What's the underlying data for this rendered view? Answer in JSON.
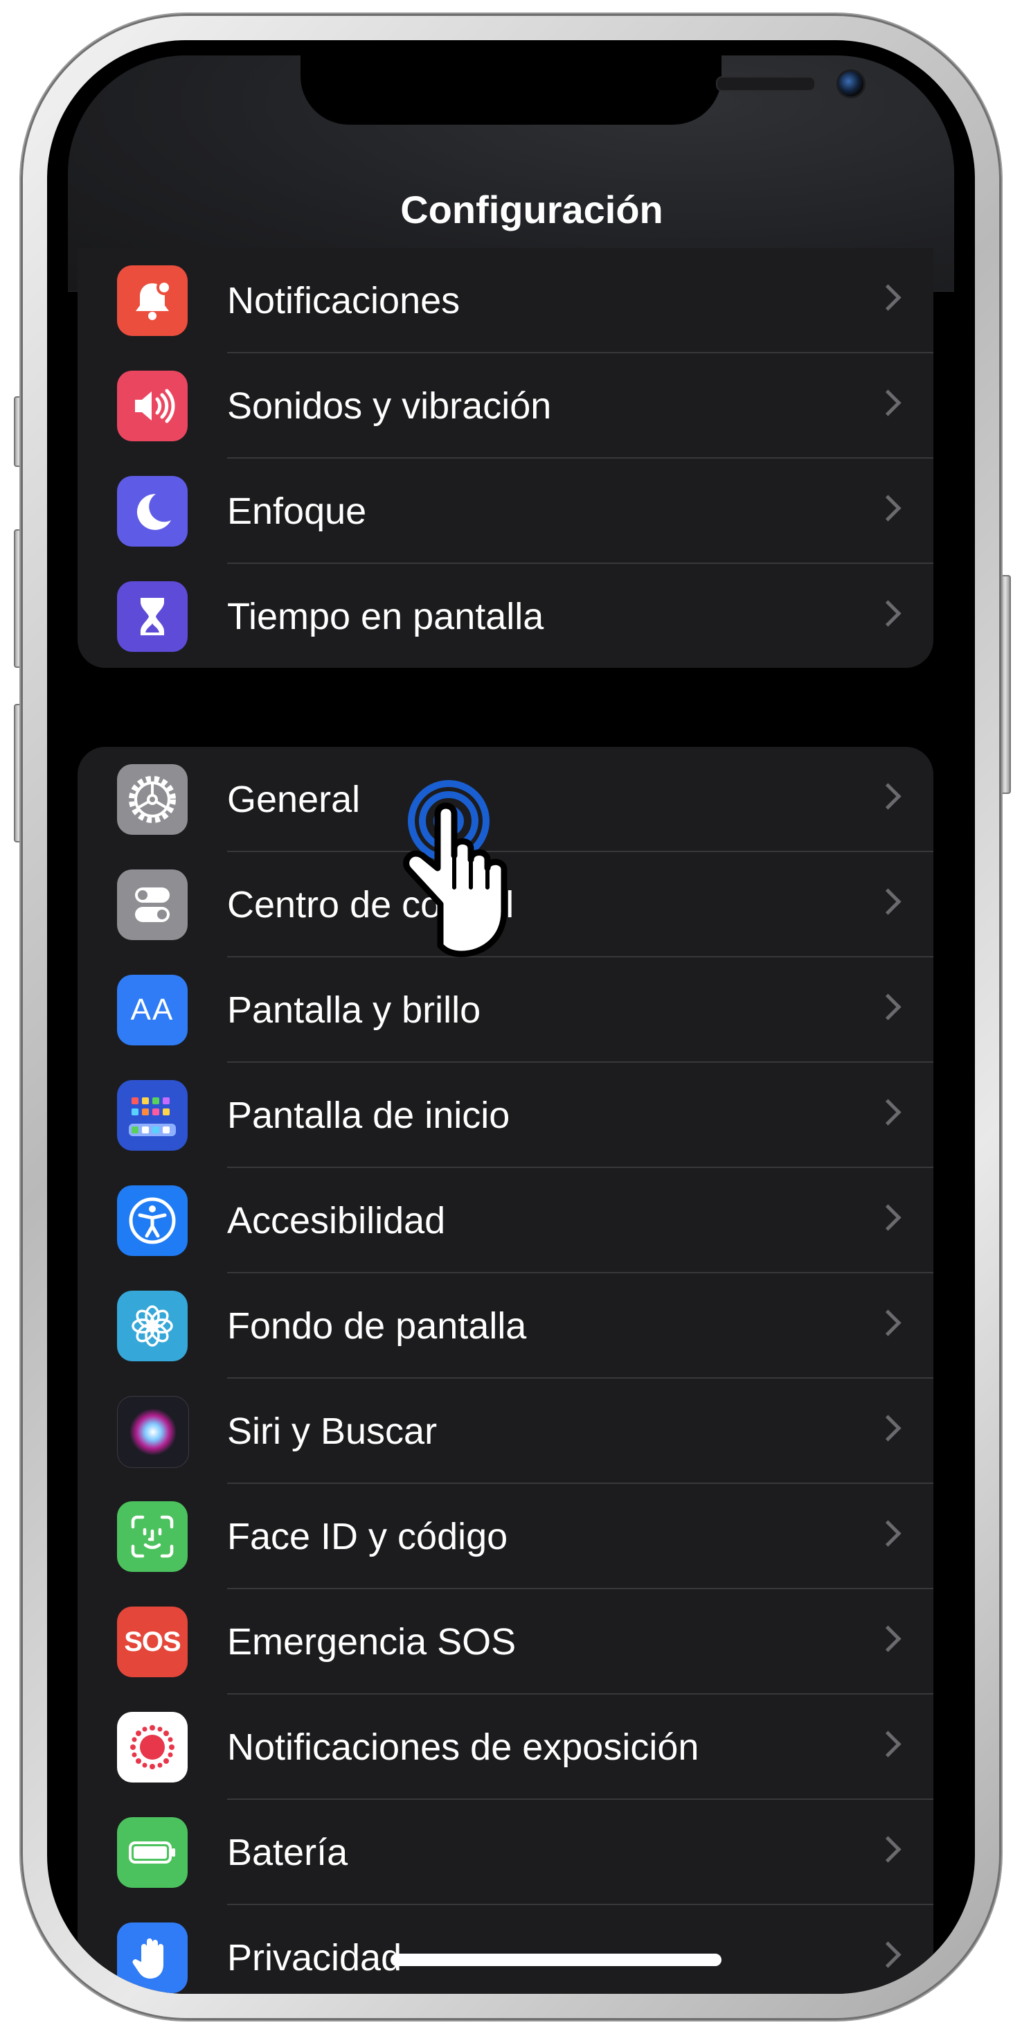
{
  "screen": {
    "title": "Configuración"
  },
  "groups": [
    {
      "items": [
        {
          "label": "Notificaciones",
          "icon": "notifications-bell-icon",
          "color": "#eb4e3d"
        },
        {
          "label": "Sonidos y vibración",
          "icon": "speaker-sound-icon",
          "color": "#eb4660"
        },
        {
          "label": "Enfoque",
          "icon": "moon-icon",
          "color": "#5e5ce6"
        },
        {
          "label": "Tiempo en pantalla",
          "icon": "hourglass-icon",
          "color": "#5e4bd8"
        }
      ]
    },
    {
      "items": [
        {
          "label": "General",
          "icon": "gear-icon",
          "color": "#8e8e93"
        },
        {
          "label": "Centro de control",
          "icon": "toggles-icon",
          "color": "#8e8e93"
        },
        {
          "label": "Pantalla y brillo",
          "icon": "text-size-icon",
          "color": "#2f7cf6",
          "glyph": "AA"
        },
        {
          "label": "Pantalla de inicio",
          "icon": "home-screen-grid-icon",
          "color": "#2e53d1"
        },
        {
          "label": "Accesibilidad",
          "icon": "accessibility-icon",
          "color": "#1f7cf4"
        },
        {
          "label": "Fondo de pantalla",
          "icon": "flower-icon",
          "color": "#35a7d8"
        },
        {
          "label": "Siri y Buscar",
          "icon": "siri-icon",
          "color": "#1c1c24"
        },
        {
          "label": "Face ID y código",
          "icon": "face-id-icon",
          "color": "#4cc25e"
        },
        {
          "label": "Emergencia SOS",
          "icon": "sos-icon",
          "color": "#e5463a",
          "glyph": "SOS"
        },
        {
          "label": "Notificaciones de exposición",
          "icon": "exposure-notification-icon",
          "color": "#ffffff"
        },
        {
          "label": "Batería",
          "icon": "battery-icon",
          "color": "#4cc25e"
        },
        {
          "label": "Privacidad",
          "icon": "hand-icon",
          "color": "#2f7cf6"
        }
      ]
    }
  ],
  "colors": {
    "background": "#000000",
    "row_background": "#1c1c1e",
    "chevron": "#6b6b6f",
    "tap_ring": "#1a5fd1"
  },
  "overlay": {
    "pointer_icon": "tap-hand-cursor-icon"
  }
}
